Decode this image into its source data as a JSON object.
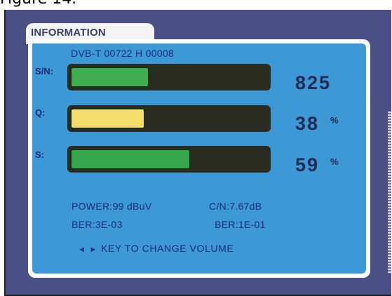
{
  "caption": "Figure 14.",
  "screen": {
    "tab_title": "INFORMATION",
    "signal_line": "DVB-T 00722 H 00008",
    "meters": [
      {
        "label": "S/N:",
        "value": "825",
        "unit": "",
        "fill_fraction": 0.4,
        "color": "#3fae4f"
      },
      {
        "label": "Q:",
        "value": "38",
        "unit": "%",
        "fill_fraction": 0.38,
        "color": "#f4dd6a"
      },
      {
        "label": "S:",
        "value": "59",
        "unit": "%",
        "fill_fraction": 0.61,
        "color": "#35a74a"
      }
    ],
    "stats": {
      "power": "POWER:99 dBuV",
      "cn": "C/N:7.67dB",
      "ber_left": "BER:3E-03",
      "ber_right": "BER:1E-01"
    },
    "hint": {
      "arrow_left": "◄",
      "arrow_right": "►",
      "text": "KEY TO CHANGE VOLUME"
    }
  }
}
